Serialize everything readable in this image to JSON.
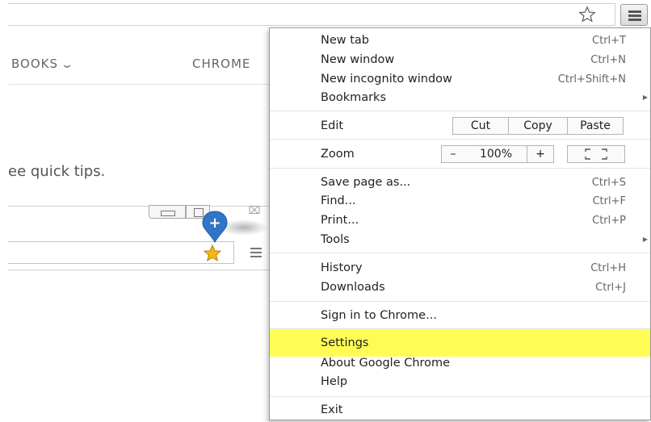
{
  "browser": {
    "menu_icon": "hamburger-icon",
    "bookmark_icon": "star-outline-icon"
  },
  "background_page": {
    "nav_books": "BOOKS",
    "nav_chrome": "CHROME",
    "tips_text": "ee quick tips."
  },
  "illustration": {
    "close_glyph": "⌧",
    "pin_glyph": "+",
    "bookmark_icon": "star-filled-icon",
    "accent_color": "#2f76c9",
    "star_color": "#f7b514"
  },
  "menu": {
    "items": {
      "new_tab": {
        "label": "New tab",
        "shortcut": "Ctrl+T"
      },
      "new_window": {
        "label": "New window",
        "shortcut": "Ctrl+N"
      },
      "new_incognito": {
        "label": "New incognito window",
        "shortcut": "Ctrl+Shift+N"
      },
      "bookmarks": {
        "label": "Bookmarks"
      },
      "edit": {
        "label": "Edit",
        "cut": "Cut",
        "copy": "Copy",
        "paste": "Paste"
      },
      "zoom": {
        "label": "Zoom",
        "minus": "–",
        "level": "100%",
        "plus": "+"
      },
      "save_page": {
        "label": "Save page as...",
        "shortcut": "Ctrl+S"
      },
      "find": {
        "label": "Find...",
        "shortcut": "Ctrl+F"
      },
      "print": {
        "label": "Print...",
        "shortcut": "Ctrl+P"
      },
      "tools": {
        "label": "Tools"
      },
      "history": {
        "label": "History",
        "shortcut": "Ctrl+H"
      },
      "downloads": {
        "label": "Downloads",
        "shortcut": "Ctrl+J"
      },
      "sign_in": {
        "label": "Sign in to Chrome..."
      },
      "settings": {
        "label": "Settings"
      },
      "about": {
        "label": "About Google Chrome"
      },
      "help": {
        "label": "Help"
      },
      "exit": {
        "label": "Exit"
      }
    },
    "submenu_arrow": "▶",
    "highlight_color": "#fffd54"
  }
}
